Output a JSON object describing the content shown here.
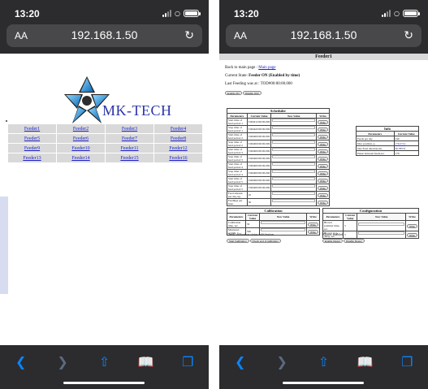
{
  "left": {
    "status": {
      "time": "13:20"
    },
    "address": {
      "aa": "AA",
      "url": "192.168.1.50"
    },
    "brand": "MK-TECH",
    "feeders": [
      [
        "Feeder1",
        "Feeder2",
        "Feeder3",
        "Feeder4"
      ],
      [
        "Feeder5",
        "Feeder6",
        "Feeder7",
        "Feeder8"
      ],
      [
        "Feeder9",
        "Feeder10",
        "Feeder11",
        "Feeder12"
      ],
      [
        "Feeder13",
        "Feeder14",
        "Feeder15",
        "Feeder16"
      ]
    ]
  },
  "right": {
    "status": {
      "time": "13:20"
    },
    "address": {
      "aa": "AA",
      "url": "192.168.1.50"
    },
    "title": "Feeder1",
    "back_text": "Back to main page :",
    "back_link": "Main page",
    "state_label": "Current State:",
    "state_value": "Feeder ON (Enabled by time)",
    "last_feeding": "Last Feeding was at : TOD#00:00:00.000",
    "btn_enable": "Enable ON",
    "btn_disable": "Disable OFF",
    "scheduler": {
      "caption": "Scheduler",
      "headers": [
        "Parameters",
        "Current Value",
        "New Value",
        "Write"
      ],
      "rows": [
        {
          "param": "Start time of feed period 1",
          "current": "TOD#12:00:00.000",
          "btn": "Write"
        },
        {
          "param": "Stop time of feed period 1",
          "current": "TOD#20:00:00.000",
          "btn": "Write"
        },
        {
          "param": "Start time of feed period 2",
          "current": "TOD#00:00:00.000",
          "btn": "Write"
        },
        {
          "param": "Stop time of feed period 2",
          "current": "TOD#00:00:00.000",
          "btn": "Write"
        },
        {
          "param": "Start time of feed period 3",
          "current": "TOD#00:00:00.000",
          "btn": "Write"
        },
        {
          "param": "Stop time of feed period 3",
          "current": "TOD#00:00:00.000",
          "btn": "Write"
        },
        {
          "param": "Start time of feed period 4",
          "current": "TOD#00:00:00.000",
          "btn": "Write"
        },
        {
          "param": "Stop time of feed period 4",
          "current": "TOD#00:00:00.000",
          "btn": "Write"
        },
        {
          "param": "Start time of feed period 5",
          "current": "TOD#00:00:00.000",
          "btn": "Write"
        },
        {
          "param": "Stop time of feed period 5",
          "current": "TOD#00:00:00.000",
          "btn": "Write"
        },
        {
          "param": "Feed amount per day, kg",
          "current": "25",
          "btn": "Write"
        },
        {
          "param": "Feedings per hour",
          "current": "30",
          "btn": "Write"
        }
      ]
    },
    "info": {
      "caption": "Info",
      "headers": [
        "Parameters",
        "Current Value"
      ],
      "rows": [
        {
          "param": "Feeds per day",
          "value": "240"
        },
        {
          "param": "Disc position, p.",
          "value": "176.2714"
        },
        {
          "param": "One Feed duration,ms",
          "value": "30.78572"
        },
        {
          "param": "Pause between feeds,sec",
          "value": "170"
        }
      ]
    },
    "calibration": {
      "caption": "Calibration",
      "headers": [
        "Parameters",
        "Current Value",
        "New Value",
        "Write"
      ],
      "rows": [
        {
          "param": "Calibration time, sec",
          "current": "30",
          "btn": "Write"
        },
        {
          "param": "Measured weight, g",
          "current": "500",
          "btn": "Write"
        }
      ],
      "note": "Check calibration status with button",
      "btn_start": "Start Calibration",
      "btn_status": "Check end of calibration"
    },
    "configuration": {
      "caption": "Configuration",
      "headers": [
        "Parameters",
        "Current Value",
        "New Value",
        "Write"
      ],
      "rows": [
        {
          "param": "Blower pretimer time, sec",
          "current": "5",
          "btn": "Write"
        },
        {
          "param": "Blower stop delay, sec",
          "current": "5",
          "btn": "Write"
        }
      ],
      "note": "Blower enabled",
      "btn_on": "Enable blower",
      "btn_off": "Disable blower"
    }
  }
}
